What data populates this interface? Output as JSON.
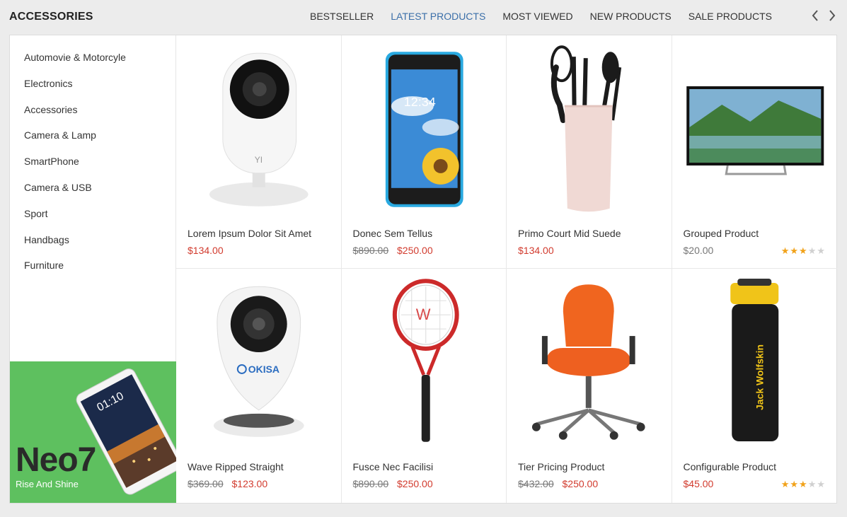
{
  "header": {
    "title": "ACCESSORIES",
    "tabs": [
      {
        "label": "BESTSELLER"
      },
      {
        "label": "LATEST PRODUCTS"
      },
      {
        "label": "MOST VIEWED"
      },
      {
        "label": "NEW PRODUCTS"
      },
      {
        "label": "SALE PRODUCTS"
      }
    ],
    "active_tab": "LATEST PRODUCTS",
    "prev_icon": "chevron-left-icon",
    "next_icon": "chevron-right-icon"
  },
  "sidebar": {
    "categories": [
      {
        "label": "Automovie & Motorcyle"
      },
      {
        "label": "Electronics"
      },
      {
        "label": "Accessories"
      },
      {
        "label": "Camera & Lamp"
      },
      {
        "label": "SmartPhone"
      },
      {
        "label": "Camera & USB"
      },
      {
        "label": "Sport"
      },
      {
        "label": "Handbags"
      },
      {
        "label": "Furniture"
      }
    ],
    "banner": {
      "title": "Neo7",
      "subtitle": "Rise And Shine",
      "phone_time": "01:10"
    }
  },
  "products": [
    {
      "name": "Lorem Ipsum Dolor Sit Amet",
      "old_price": "",
      "price": "$134.00",
      "rating": 0
    },
    {
      "name": "Donec Sem Tellus",
      "old_price": "$890.00",
      "price": "$250.00",
      "rating": 0
    },
    {
      "name": "Primo Court Mid Suede",
      "old_price": "",
      "price": "$134.00",
      "rating": 0
    },
    {
      "name": "Grouped Product",
      "old_price": "",
      "price": "$20.00",
      "rating": 3
    },
    {
      "name": "Wave Ripped Straight",
      "old_price": "$369.00",
      "price": "$123.00",
      "rating": 0
    },
    {
      "name": "Fusce Nec Facilisi",
      "old_price": "$890.00",
      "price": "$250.00",
      "rating": 0
    },
    {
      "name": "Tier Pricing Product",
      "old_price": "$432.00",
      "price": "$250.00",
      "rating": 0
    },
    {
      "name": "Configurable Product",
      "old_price": "",
      "price": "$45.00",
      "rating": 3
    }
  ],
  "product_images": {
    "p0": "home-camera-icon",
    "p1": "smartphone-icon",
    "p2": "kitchen-utensils-icon",
    "p3": "television-icon",
    "p4": "ip-camera-icon",
    "p5": "tennis-racket-icon",
    "p6": "office-chair-icon",
    "p7": "water-bottle-icon",
    "okisa_logo": "OKISA",
    "yi_logo": "YI",
    "jack_logo": "Jack Wolfskin",
    "phone_clock": "12:34"
  },
  "colors": {
    "accent": "#3b6fa9",
    "sale_price": "#d23b2e",
    "star": "#f1a21a",
    "banner_bg": "#5ec05f"
  }
}
